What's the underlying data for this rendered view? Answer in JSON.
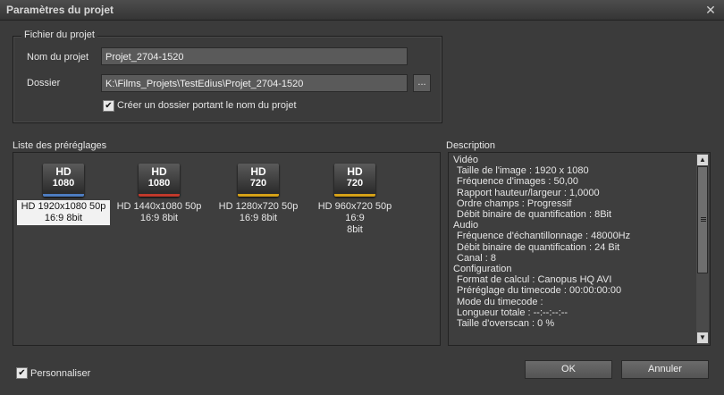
{
  "window": {
    "title": "Paramètres du projet"
  },
  "project_file": {
    "legend": "Fichier du projet",
    "name_label": "Nom du projet",
    "name_value": "Projet_2704-1520",
    "folder_label": "Dossier",
    "folder_value": "K:\\Films_Projets\\TestEdius\\Projet_2704-1520",
    "browse_label": "...",
    "create_folder_label": "Créer un dossier portant le nom du projet",
    "create_folder_checked": true
  },
  "presets": {
    "label": "Liste des préréglages",
    "items": [
      {
        "badge_top": "HD",
        "badge_bottom": "1080",
        "accent": "#4d7cc0",
        "line1": "HD 1920x1080 50p",
        "line2": "16:9 8bit",
        "selected": true
      },
      {
        "badge_top": "HD",
        "badge_bottom": "1080",
        "accent": "#c0392b",
        "line1": "HD 1440x1080 50p",
        "line2": "16:9 8bit",
        "selected": false
      },
      {
        "badge_top": "HD",
        "badge_bottom": "720",
        "accent": "#d4a017",
        "line1": "HD 1280x720 50p",
        "line2": "16:9 8bit",
        "selected": false
      },
      {
        "badge_top": "HD",
        "badge_bottom": "720",
        "accent": "#d4a017",
        "line1": "HD 960x720 50p 16:9",
        "line2": "8bit",
        "selected": false
      }
    ]
  },
  "description": {
    "label": "Description",
    "lines": [
      {
        "text": "Vidéo",
        "indent": false
      },
      {
        "text": "Taille de l'image : 1920 x 1080",
        "indent": true
      },
      {
        "text": "Fréquence d'images : 50,00",
        "indent": true
      },
      {
        "text": "Rapport hauteur/largeur : 1,0000",
        "indent": true
      },
      {
        "text": "Ordre champs : Progressif",
        "indent": true
      },
      {
        "text": "Débit binaire de quantification : 8Bit",
        "indent": true
      },
      {
        "text": "Audio",
        "indent": false
      },
      {
        "text": "Fréquence d'échantillonnage : 48000Hz",
        "indent": true
      },
      {
        "text": "Débit binaire de quantification : 24 Bit",
        "indent": true
      },
      {
        "text": "Canal : 8",
        "indent": true
      },
      {
        "text": "Configuration",
        "indent": false
      },
      {
        "text": "Format de calcul : Canopus HQ AVI",
        "indent": true
      },
      {
        "text": "Préréglage du timecode : 00:00:00:00",
        "indent": true
      },
      {
        "text": "Mode du timecode :",
        "indent": true
      },
      {
        "text": "Longueur totale : --:--:--:--",
        "indent": true
      },
      {
        "text": "Taille d'overscan : 0 %",
        "indent": true
      }
    ]
  },
  "footer": {
    "customize_label": "Personnaliser",
    "customize_checked": true,
    "ok_label": "OK",
    "cancel_label": "Annuler"
  },
  "icons": {
    "close": "close-icon",
    "checkmark": "checkmark-icon",
    "scroll_up": "arrow-up-icon",
    "scroll_down": "arrow-down-icon"
  }
}
